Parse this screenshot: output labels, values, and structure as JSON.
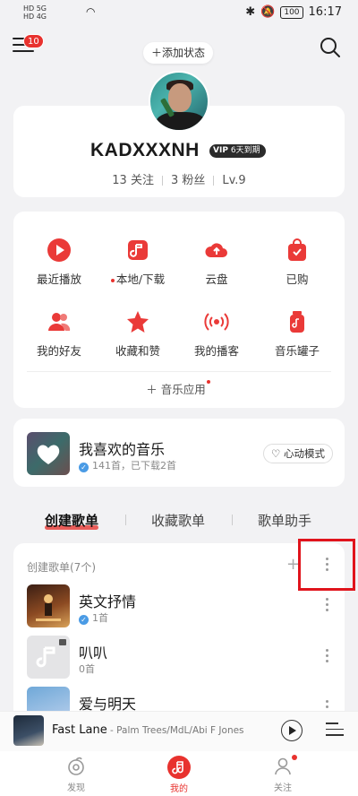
{
  "status_bar": {
    "left_indicators": [
      "HD 5G",
      "HD 4G"
    ],
    "battery": "100",
    "time": "16:17"
  },
  "header": {
    "menu_badge": "10",
    "add_status_label": "添加状态"
  },
  "profile": {
    "username": "KADXXXNH",
    "vip_badge": "6天到期",
    "vip_label": "VIP",
    "follows": "13 关注",
    "fans": "3 粉丝",
    "level": "Lv.9"
  },
  "grid": {
    "items": [
      {
        "label": "最近播放",
        "icon": "play-icon"
      },
      {
        "label": "本地/下载",
        "icon": "music-note-icon"
      },
      {
        "label": "云盘",
        "icon": "cloud-upload-icon"
      },
      {
        "label": "已购",
        "icon": "shopping-bag-icon"
      },
      {
        "label": "我的好友",
        "icon": "friends-icon"
      },
      {
        "label": "收藏和赞",
        "icon": "star-icon"
      },
      {
        "label": "我的播客",
        "icon": "podcast-icon"
      },
      {
        "label": "音乐罐子",
        "icon": "music-jar-icon"
      }
    ],
    "music_apps_label": "音乐应用"
  },
  "liked": {
    "title": "我喜欢的音乐",
    "subtitle": "141首，已下载2首",
    "heart_mode_label": "心动模式"
  },
  "playlist_tabs": {
    "created": "创建歌单",
    "collected": "收藏歌单",
    "assistant": "歌单助手"
  },
  "playlists": {
    "header": "创建歌单(7个)",
    "items": [
      {
        "title": "英文抒情",
        "count": "1首"
      },
      {
        "title": "叭叭",
        "count": "0首"
      },
      {
        "title": "爱与明天",
        "count": ""
      }
    ]
  },
  "mini_player": {
    "title": "Fast Lane",
    "artist": " - Palm Trees/MdL/Abi F Jones"
  },
  "tab_bar": {
    "discover": "发现",
    "mine": "我的",
    "follow": "关注"
  },
  "colors": {
    "accent": "#e8322e",
    "background": "#f2f2f4"
  }
}
